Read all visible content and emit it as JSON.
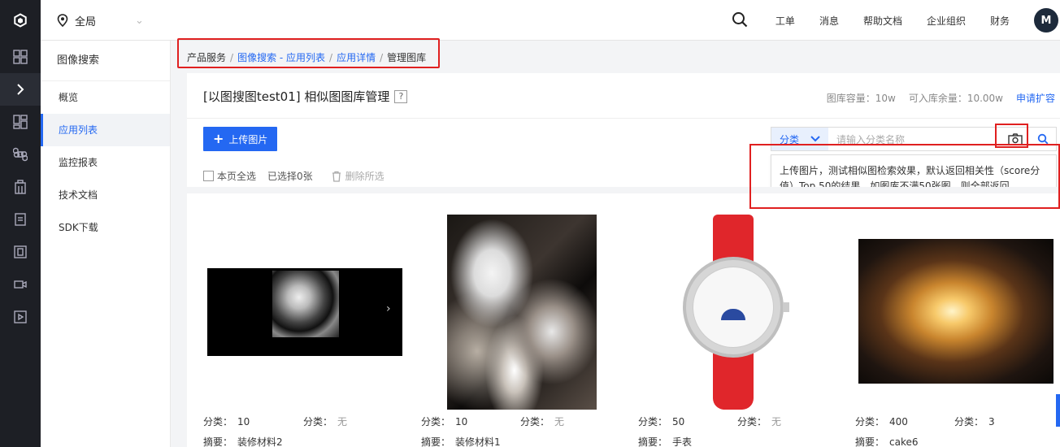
{
  "topbar": {
    "region": "全局",
    "nav": [
      "工单",
      "消息",
      "帮助文档",
      "企业组织",
      "财务"
    ],
    "avatar": "M"
  },
  "sidebar": {
    "title": "图像搜索",
    "items": [
      {
        "label": "概览",
        "active": false
      },
      {
        "label": "应用列表",
        "active": true
      },
      {
        "label": "监控报表",
        "active": false
      },
      {
        "label": "技术文档",
        "active": false
      },
      {
        "label": "SDK下载",
        "active": false
      }
    ]
  },
  "breadcrumb": {
    "items": [
      "产品服务",
      "图像搜索 - 应用列表",
      "应用详情",
      "管理图库"
    ],
    "separator": "/"
  },
  "page": {
    "title": "[以图搜图test01] 相似图图库管理",
    "help": "?",
    "capacity": "图库容量：10w",
    "remaining": "可入库余量：10.00w",
    "apply": "申请扩容"
  },
  "toolbar": {
    "upload": "上传图片",
    "category": "分类",
    "search_placeholder": "请输入分类名称",
    "tip": "上传图片，测试相似图检索效果，默认返回相关性（score分值）Top 50的结果，如图库不满50张图，则全部返回"
  },
  "selection": {
    "select_all": "本页全选",
    "selected": "已选择0张",
    "delete": "删除所选"
  },
  "gallery": [
    {
      "cat1_label": "分类：",
      "cat1_value": "10",
      "cat2_label": "分类：",
      "cat2_value": "无",
      "summary_label": "摘要：",
      "summary": "装修材料2"
    },
    {
      "cat1_label": "分类：",
      "cat1_value": "10",
      "cat2_label": "分类：",
      "cat2_value": "无",
      "summary_label": "摘要：",
      "summary": "装修材料1"
    },
    {
      "cat1_label": "分类：",
      "cat1_value": "50",
      "cat2_label": "分类：",
      "cat2_value": "无",
      "summary_label": "摘要：",
      "summary": "手表"
    },
    {
      "cat1_label": "分类：",
      "cat1_value": "400",
      "cat2_label": "分类：",
      "cat2_value": "3",
      "summary_label": "摘要：",
      "summary": "cake6"
    }
  ],
  "colors": {
    "accent": "#2468f2",
    "highlight": "#e02020",
    "rail": "#1d1f25"
  }
}
